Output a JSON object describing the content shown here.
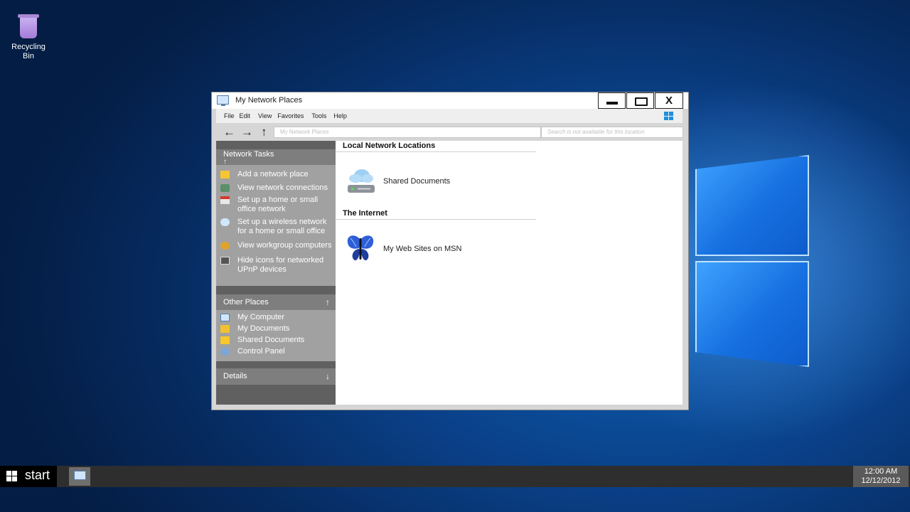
{
  "desktop": {
    "recycle_bin_label": "Recycling Bin"
  },
  "window": {
    "title": "My Network Places",
    "close_label": "X",
    "menu": [
      "File",
      "Edit",
      "View",
      "Favorites",
      "Tools",
      "Help"
    ],
    "nav": {
      "back": "←",
      "forward": "→",
      "up": "↑"
    },
    "address_placeholder": "My Network Places",
    "search_placeholder": "Search is not available for this location"
  },
  "sidebar": {
    "network_tasks": {
      "title": "Network Tasks",
      "arrow": "↑",
      "items": [
        {
          "label": "Add a network place",
          "icon": "folder-star-icon"
        },
        {
          "label": "View network connections",
          "icon": "network-connections-icon"
        },
        {
          "label": "Set up a home or small office network",
          "icon": "home-network-icon"
        },
        {
          "label": "Set up a wireless network for a home or small office",
          "icon": "wireless-icon"
        },
        {
          "label": "View workgroup computers",
          "icon": "workgroup-icon"
        },
        {
          "label": "Hide icons for networked UPnP devices",
          "icon": "upnp-icon"
        }
      ]
    },
    "other_places": {
      "title": "Other Places",
      "arrow": "↑",
      "items": [
        {
          "label": "My Computer",
          "icon": "computer-icon"
        },
        {
          "label": "My Documents",
          "icon": "documents-folder-icon"
        },
        {
          "label": "Shared Documents",
          "icon": "shared-folder-icon"
        },
        {
          "label": "Control Panel",
          "icon": "control-panel-icon"
        }
      ]
    },
    "details": {
      "title": "Details",
      "arrow": "↓"
    }
  },
  "content": {
    "groups": [
      {
        "title": "Local Network Locations",
        "items": [
          {
            "label": "Shared Documents",
            "icon": "cloud-drive-icon"
          }
        ]
      },
      {
        "title": "The Internet",
        "items": [
          {
            "label": "My Web Sites on MSN",
            "icon": "msn-butterfly-icon"
          }
        ]
      }
    ]
  },
  "taskbar": {
    "start_label": "start",
    "clock_time": "12:00 AM",
    "clock_date": "12/12/2012"
  },
  "colors": {
    "sidebar_body": "#a1a1a1",
    "sidebar_header": "#7e7e7e",
    "taskbar": "#2e2e2e",
    "desktop_blue": "#0a3f86"
  }
}
